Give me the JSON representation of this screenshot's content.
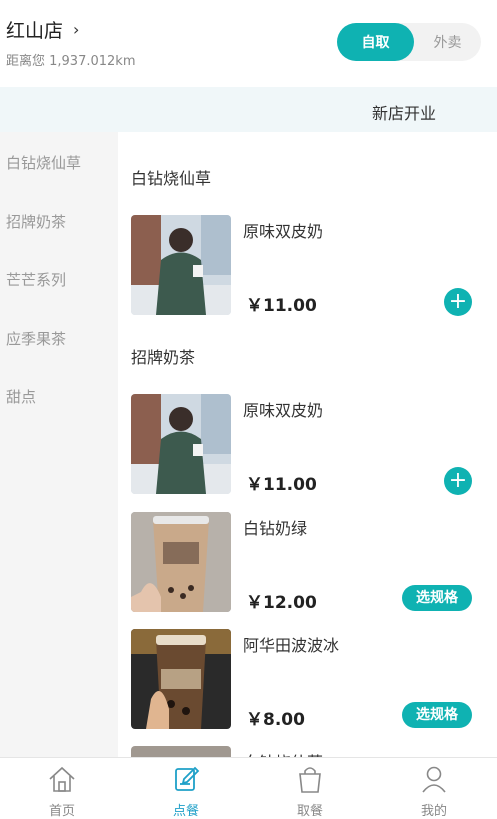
{
  "header": {
    "store_name": "红山店",
    "chevron": "›",
    "distance": "距离您 1,937.012km",
    "mode_pickup": "自取",
    "mode_delivery": "外卖"
  },
  "banner": {
    "text": "新店开业"
  },
  "sidebar": {
    "categories": [
      {
        "label": "白钻烧仙草"
      },
      {
        "label": "招牌奶茶"
      },
      {
        "label": "芒芒系列"
      },
      {
        "label": "应季果茶"
      },
      {
        "label": "甜点"
      }
    ]
  },
  "menu": {
    "sections": [
      {
        "title": "白钻烧仙草",
        "items": [
          {
            "name": "原味双皮奶",
            "price": "￥11.00",
            "action": "+"
          }
        ]
      },
      {
        "title": "招牌奶茶",
        "items": [
          {
            "name": "原味双皮奶",
            "price": "￥11.00",
            "action": "+"
          },
          {
            "name": "白钻奶绿",
            "price": "￥12.00",
            "action": "选规格"
          },
          {
            "name": "阿华田波波冰",
            "price": "￥8.00",
            "action": "选规格"
          },
          {
            "name": "白钻烧仙草",
            "price": "",
            "action": ""
          }
        ]
      }
    ]
  },
  "tabbar": {
    "tabs": [
      {
        "label": "首页",
        "icon": "home-icon"
      },
      {
        "label": "点餐",
        "icon": "order-icon"
      },
      {
        "label": "取餐",
        "icon": "bag-icon"
      },
      {
        "label": "我的",
        "icon": "user-icon"
      }
    ],
    "active": "点餐"
  },
  "colors": {
    "accent": "#0fb2b2",
    "tab_active": "#1fa0c8"
  }
}
